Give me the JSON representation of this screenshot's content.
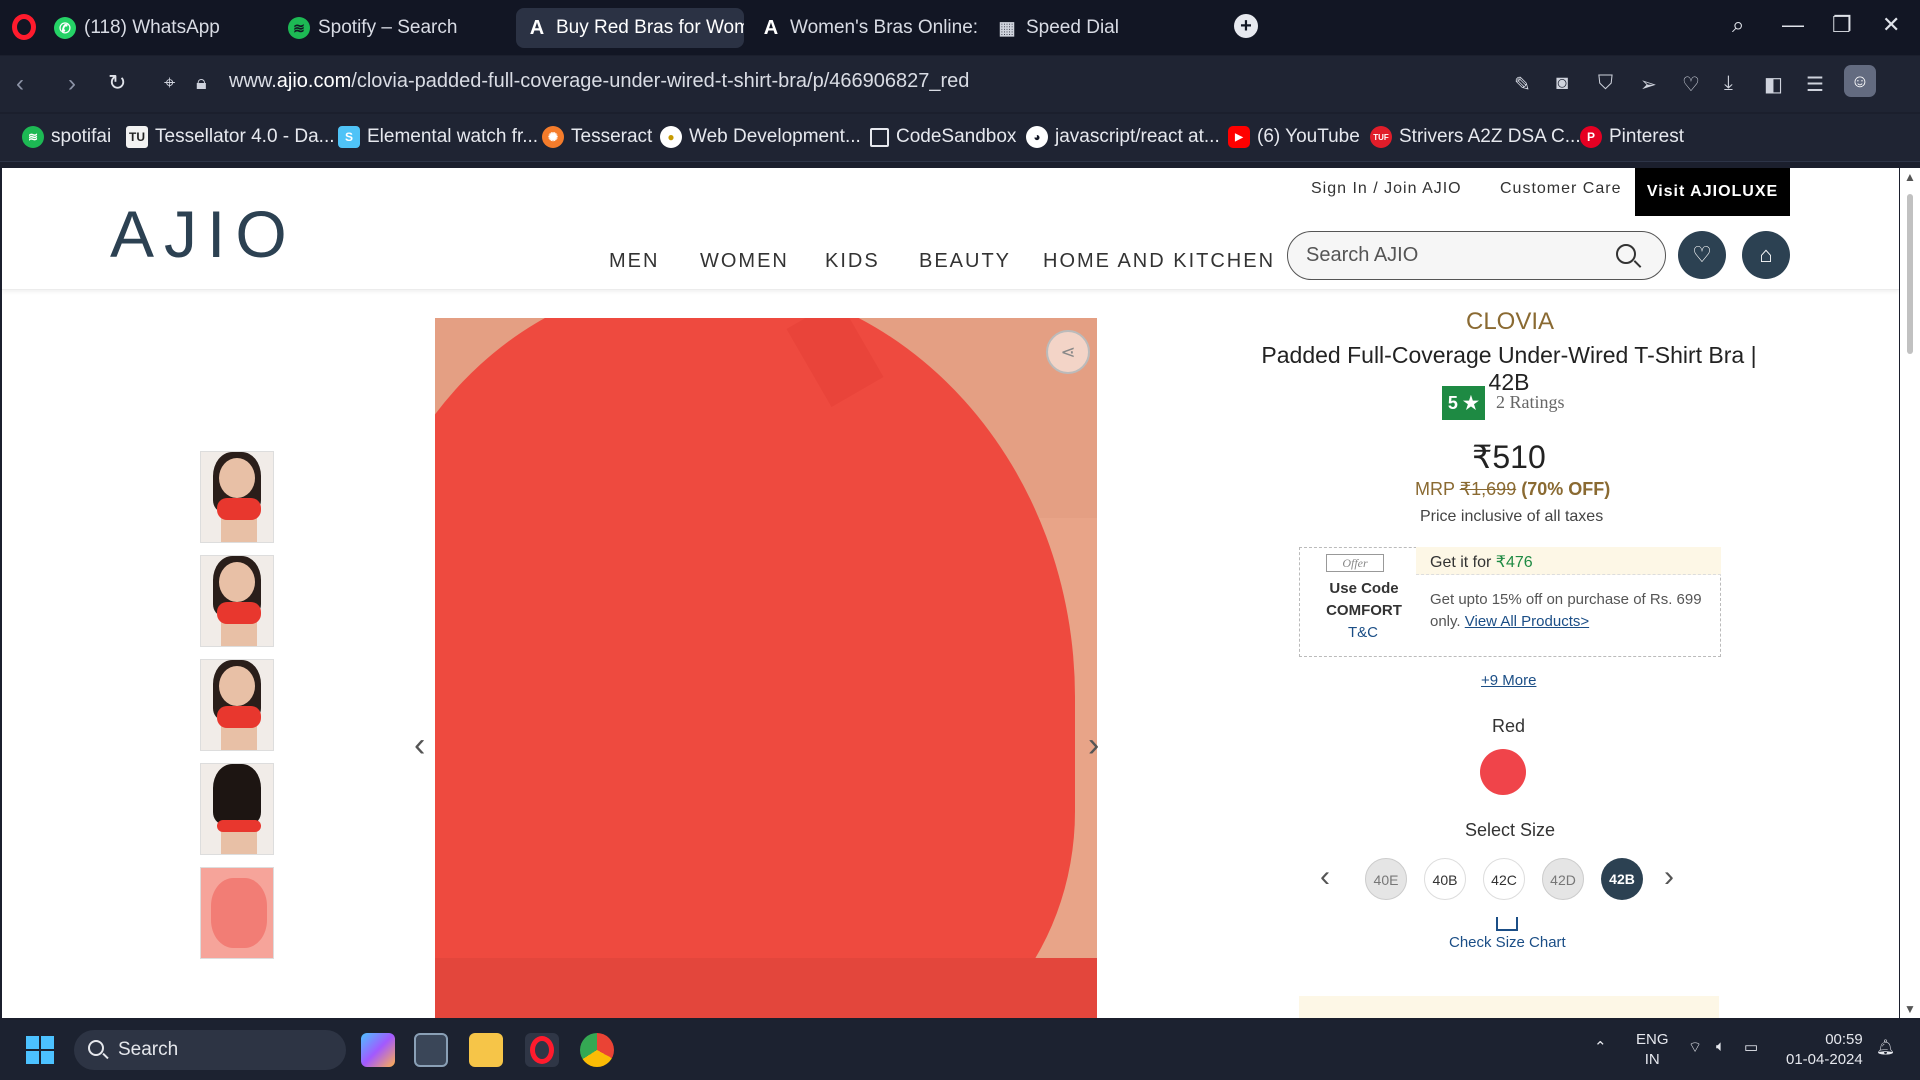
{
  "browser": {
    "tabs": [
      {
        "label": "(118) WhatsApp",
        "icon": "whatsapp-icon",
        "color": "#25d366"
      },
      {
        "label": "Spotify – Search",
        "icon": "spotify-icon",
        "color": "#1db954"
      },
      {
        "label": "Buy Red Bras for Women",
        "icon": "ajio-icon",
        "color": "#ffffff"
      },
      {
        "label": "Women's Bras Online: L",
        "icon": "ajio-icon",
        "color": "#ffffff"
      },
      {
        "label": "Speed Dial",
        "icon": "grid-icon",
        "color": "#cfd3dd"
      }
    ],
    "url_prefix": "www.",
    "url_domain": "ajio.com",
    "url_path": "/clovia-padded-full-coverage-under-wired-t-shirt-bra/p/466906827_red",
    "bookmarks": [
      {
        "label": "spotifai",
        "icon": "spotify-icon"
      },
      {
        "label": "Tessellator 4.0 - Da...",
        "icon": "tu-icon"
      },
      {
        "label": "Elemental watch fr...",
        "icon": "s-icon"
      },
      {
        "label": "Tesseract",
        "icon": "tesseract-icon"
      },
      {
        "label": "Web Development...",
        "icon": "web-icon"
      },
      {
        "label": "CodeSandbox",
        "icon": "codesandbox-icon"
      },
      {
        "label": "javascript/react at...",
        "icon": "github-icon"
      },
      {
        "label": "(6) YouTube",
        "icon": "youtube-icon"
      },
      {
        "label": "Strivers A2Z DSA C...",
        "icon": "tuf-icon"
      },
      {
        "label": "Pinterest",
        "icon": "pinterest-icon"
      }
    ]
  },
  "site": {
    "logo": "AJIO",
    "top_links": {
      "signin": "Sign In / Join AJIO",
      "care": "Customer Care",
      "luxe": "Visit AJIOLUXE"
    },
    "nav": [
      "MEN",
      "WOMEN",
      "KIDS",
      "BEAUTY",
      "HOME AND KITCHEN"
    ],
    "search_placeholder": "Search AJIO"
  },
  "product": {
    "brand": "CLOVIA",
    "name": "Padded Full-Coverage Under-Wired T-Shirt Bra | 42B",
    "rating": "5 ★",
    "ratings_count": "2 Ratings",
    "price": "₹510",
    "mrp_label": "MRP",
    "mrp": "₹1,699",
    "discount": "(70% OFF)",
    "tax_note": "Price inclusive of all taxes",
    "offer": {
      "tag": "Offer",
      "code_line1": "Use Code",
      "code_line2": "COMFORT",
      "tc": "T&C",
      "head_prefix": "Get it for ",
      "head_price": "₹476",
      "desc": "Get upto 15% off on purchase of Rs. 699 only. ",
      "desc_link": "View All Products>"
    },
    "more_offers": "+9 More",
    "color_label": "Red",
    "color_hex": "#f0444a",
    "size_label": "Select Size",
    "sizes": [
      {
        "label": "40E",
        "state": "unavailable"
      },
      {
        "label": "40B",
        "state": "available"
      },
      {
        "label": "42C",
        "state": "available"
      },
      {
        "label": "42D",
        "state": "unavailable"
      },
      {
        "label": "42B",
        "state": "selected"
      }
    ],
    "size_chart": "Check Size Chart"
  },
  "taskbar": {
    "search": "Search",
    "lang_line1": "ENG",
    "lang_line2": "IN",
    "time": "00:59",
    "date": "01-04-2024"
  }
}
